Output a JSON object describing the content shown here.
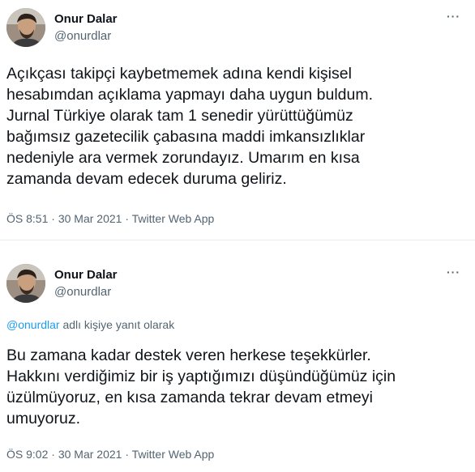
{
  "tweets": [
    {
      "author_name": "Onur Dalar",
      "author_handle": "@onurdlar",
      "more_icon": "more-horizontal-icon",
      "text_lines": [
        "Açıkçası takipçi kaybetmemek adına kendi kişisel",
        "hesabımdan açıklama yapmayı daha uygun buldum.",
        "Jurnal Türkiye olarak tam 1 senedir yürüttüğümüz",
        "bağımsız gazetecilik çabasına maddi imkansızlıklar",
        "nedeniyle ara vermek zorundayız. Umarım en kısa",
        "zamanda devam edecek duruma geliriz."
      ],
      "time": "ÖS 8:51",
      "date": "30 Mar 2021",
      "source": "Twitter Web App",
      "separator": "·"
    },
    {
      "author_name": "Onur Dalar",
      "author_handle": "@onurdlar",
      "more_icon": "more-horizontal-icon",
      "reply_mention": "@onurdlar",
      "reply_suffix": "adlı kişiye yanıt olarak",
      "text_lines": [
        "Bu zamana kadar destek veren herkese teşekkürler.",
        "Hakkını verdiğimiz bir iş yaptığımızı düşündüğümüz için",
        "üzülmüyoruz, en kısa zamanda tekrar devam etmeyi",
        "umuyoruz."
      ],
      "time": "ÖS 9:02",
      "date": "30 Mar 2021",
      "source": "Twitter Web App",
      "separator": "·"
    }
  ]
}
